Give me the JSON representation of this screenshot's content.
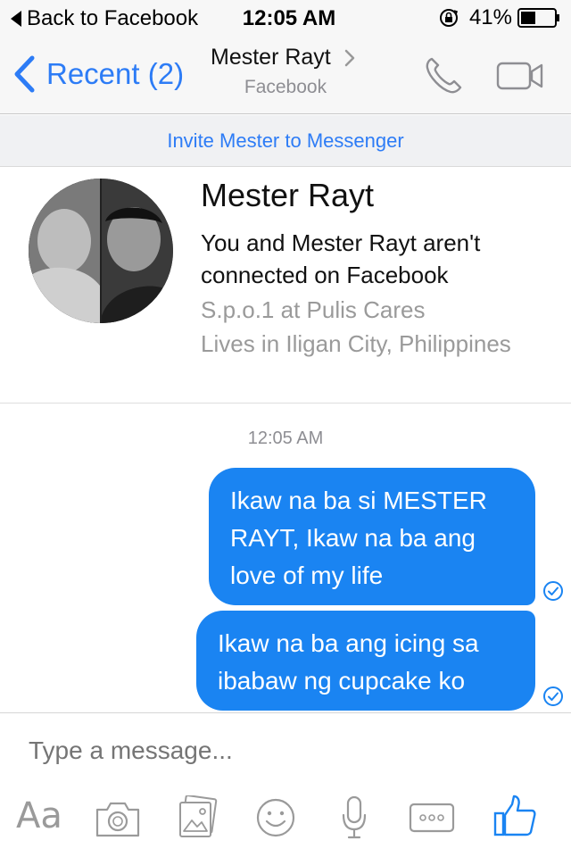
{
  "status_bar": {
    "back_label": "Back to Facebook",
    "time": "12:05 AM",
    "battery": "41%"
  },
  "nav": {
    "back_label": "Recent (2)",
    "title": "Mester Rayt",
    "subtitle": "Facebook"
  },
  "invite_banner": "Invite Mester to Messenger",
  "profile": {
    "name": "Mester Rayt",
    "connection_line1": "You and Mester Rayt aren't",
    "connection_line2": "connected on Facebook",
    "work": "S.p.o.1 at Pulis Cares",
    "lives": "Lives in Iligan City, Philippines"
  },
  "conversation": {
    "timestamp": "12:05 AM",
    "messages": [
      {
        "lines": [
          "Ikaw na ba si MESTER",
          "RAYT, Ikaw na ba ang",
          "love of my life"
        ]
      },
      {
        "lines": [
          "Ikaw na ba ang icing sa",
          "ibabaw ng cupcake ko"
        ]
      }
    ]
  },
  "composer": {
    "placeholder": "Type a message...",
    "text_format_label": "Aa"
  },
  "colors": {
    "accent": "#2d7cf6",
    "bubble": "#1a84f2"
  },
  "icons": [
    "back-triangle-icon",
    "orientation-lock-icon",
    "battery-icon",
    "chevron-left-icon",
    "chevron-right-icon",
    "phone-icon",
    "video-camera-icon",
    "read-check-icon",
    "camera-icon",
    "gallery-icon",
    "emoji-icon",
    "microphone-icon",
    "more-icon",
    "like-thumb-icon"
  ]
}
